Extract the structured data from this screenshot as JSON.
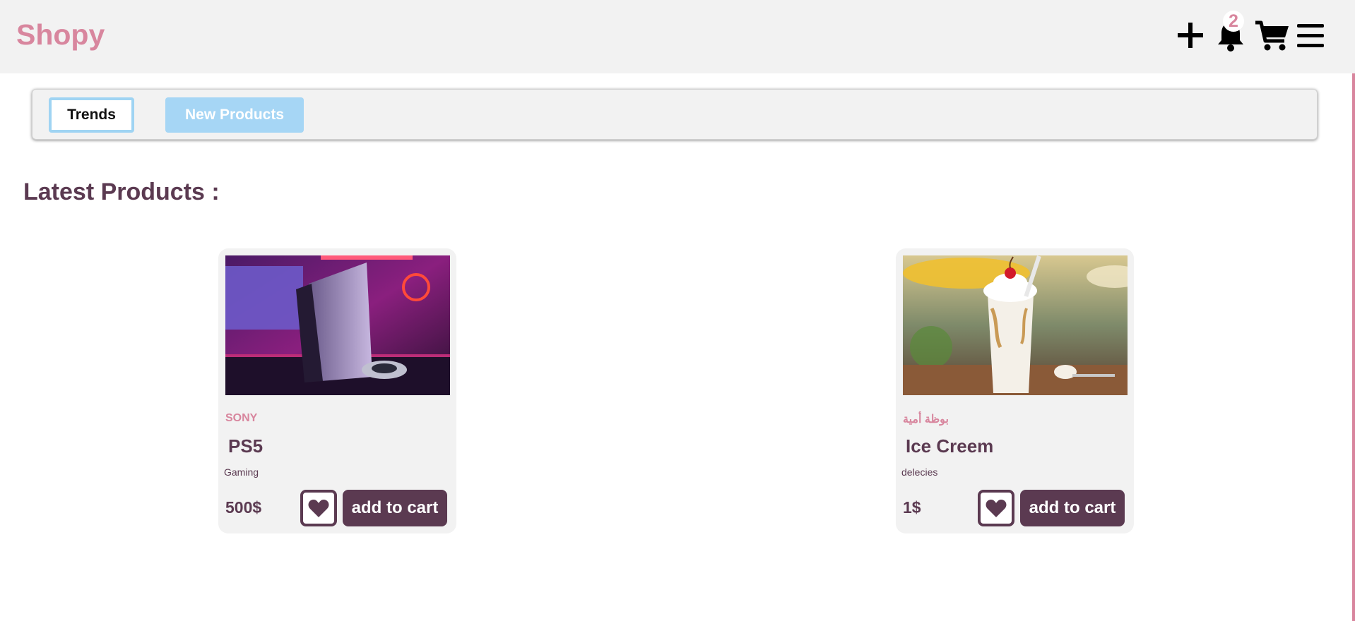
{
  "header": {
    "logo": "Shopy",
    "notification_count": "2",
    "icons": [
      "plus-icon",
      "bell-icon",
      "cart-icon",
      "menu-icon"
    ]
  },
  "tabs": {
    "trends_label": "Trends",
    "new_products_label": "New Products"
  },
  "main": {
    "section_title": "Latest Products :"
  },
  "products": [
    {
      "brand": "SONY",
      "name": "PS5",
      "category": "Gaming",
      "price": "500$",
      "cart_label": "add to cart"
    },
    {
      "brand": "بوظة أمية",
      "name": "Ice Creem",
      "category": "delecies",
      "price": "1$",
      "cart_label": "add to cart"
    }
  ],
  "colors": {
    "accent_pink": "#d8869e",
    "brand_purple": "#5b3a51",
    "tab_blue": "#a6d6f5",
    "header_bg": "#f2f2f2"
  }
}
